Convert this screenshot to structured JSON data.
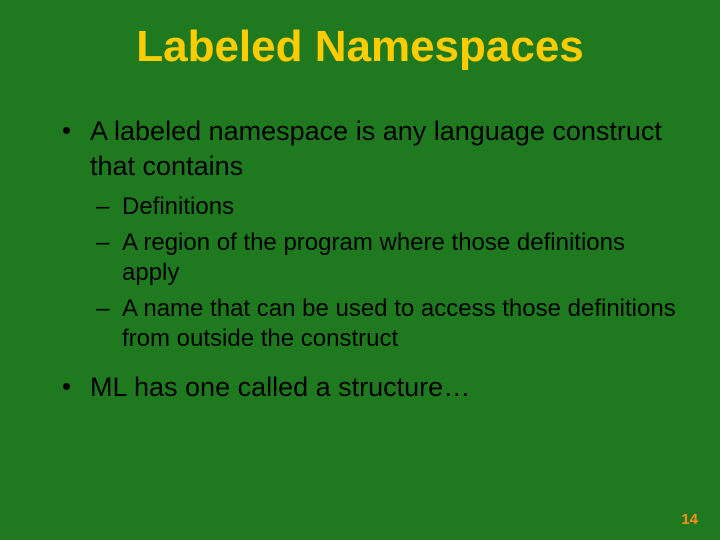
{
  "title": "Labeled Namespaces",
  "bullets": [
    {
      "text": "A labeled namespace is any language construct that contains",
      "sub": [
        "Definitions",
        "A region of the program where those definitions apply",
        "A name that can be used to access those definitions from outside the construct"
      ]
    },
    {
      "text": "ML has one called a structure…",
      "sub": []
    }
  ],
  "page_number": "14"
}
